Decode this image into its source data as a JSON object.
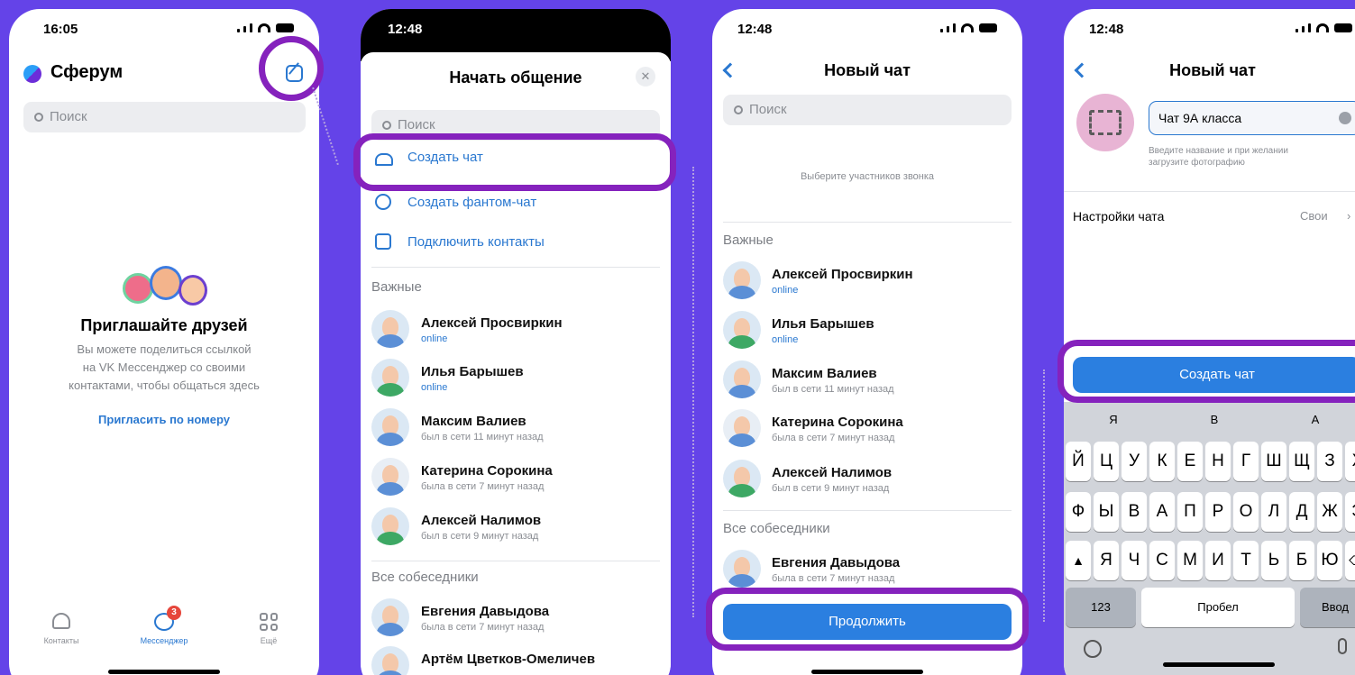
{
  "phone1": {
    "time": "16:05",
    "app_title": "Сферум",
    "search_placeholder": "Поиск",
    "invite_title": "Приглашайте друзей",
    "invite_desc": [
      "Вы можете поделиться ссылкой",
      "на VK Мессенджер со своими",
      "контактами, чтобы общаться здесь"
    ],
    "invite_link": "Пригласить по номеру",
    "nav": [
      {
        "label": "Контакты",
        "icon": "contacts-icon"
      },
      {
        "label": "Мессенджер",
        "icon": "messenger-icon",
        "badge": "3"
      },
      {
        "label": "Ещё",
        "icon": "grid-icon"
      }
    ]
  },
  "phone2": {
    "time": "12:48",
    "title": "Начать общение",
    "search_placeholder": "Поиск",
    "actions": [
      {
        "label": "Создать чат",
        "icon": "group-icon"
      },
      {
        "label": "Создать фантом-чат",
        "icon": "phantom-icon"
      },
      {
        "label": "Подключить контакты",
        "icon": "contact-card-icon"
      }
    ],
    "section_important": "Важные",
    "contacts": [
      {
        "name": "Алексей Просвиркин",
        "status": "online"
      },
      {
        "name": "Илья Барышев",
        "status": "online"
      },
      {
        "name": "Максим Валиев",
        "status": "был в сети 11 минут назад"
      },
      {
        "name": "Катерина Сорокина",
        "status": "была в сети 7 минут назад"
      },
      {
        "name": "Алексей Налимов",
        "status": "был в сети 9 минут назад"
      }
    ],
    "section_all": "Все собеседники",
    "all_contacts": [
      {
        "name": "Евгения Давыдова",
        "status": "была в сети 7 минут назад"
      },
      {
        "name": "Артём Цветков-Омеличев",
        "status": ""
      }
    ]
  },
  "phone3": {
    "time": "12:48",
    "title": "Новый чат",
    "search_placeholder": "Поиск",
    "hint": "Выберите участников звонка",
    "section_important": "Важные",
    "contacts": [
      {
        "name": "Алексей Просвиркин",
        "status": "online"
      },
      {
        "name": "Илья Барышев",
        "status": "online"
      },
      {
        "name": "Максим Валиев",
        "status": "был в сети 11 минут назад"
      },
      {
        "name": "Катерина Сорокина",
        "status": "была в сети 7 минут назад"
      },
      {
        "name": "Алексей Налимов",
        "status": "был в сети 9 минут назад"
      }
    ],
    "section_all": "Все собеседники",
    "all_contacts": [
      {
        "name": "Евгения Давыдова",
        "status": "была в сети 7 минут назад"
      }
    ],
    "continue": "Продолжить"
  },
  "phone4": {
    "time": "12:48",
    "title": "Новый чат",
    "chat_name": "Чат 9А класса",
    "name_hint": [
      "Введите название и при желании",
      "загрузите фотографию"
    ],
    "settings_label": "Настройки чата",
    "settings_value": "Свои",
    "create": "Создать чат",
    "suggestions": [
      "Я",
      "В",
      "А"
    ],
    "row1": [
      "Й",
      "Ц",
      "У",
      "К",
      "Е",
      "Н",
      "Г",
      "Ш",
      "Щ",
      "З",
      "Х"
    ],
    "row2": [
      "Ф",
      "Ы",
      "В",
      "А",
      "П",
      "Р",
      "О",
      "Л",
      "Д",
      "Ж",
      "Э"
    ],
    "row3": [
      "Я",
      "Ч",
      "С",
      "М",
      "И",
      "Т",
      "Ь",
      "Б",
      "Ю"
    ],
    "k123": "123",
    "space": "Пробел",
    "enter": "Ввод"
  }
}
